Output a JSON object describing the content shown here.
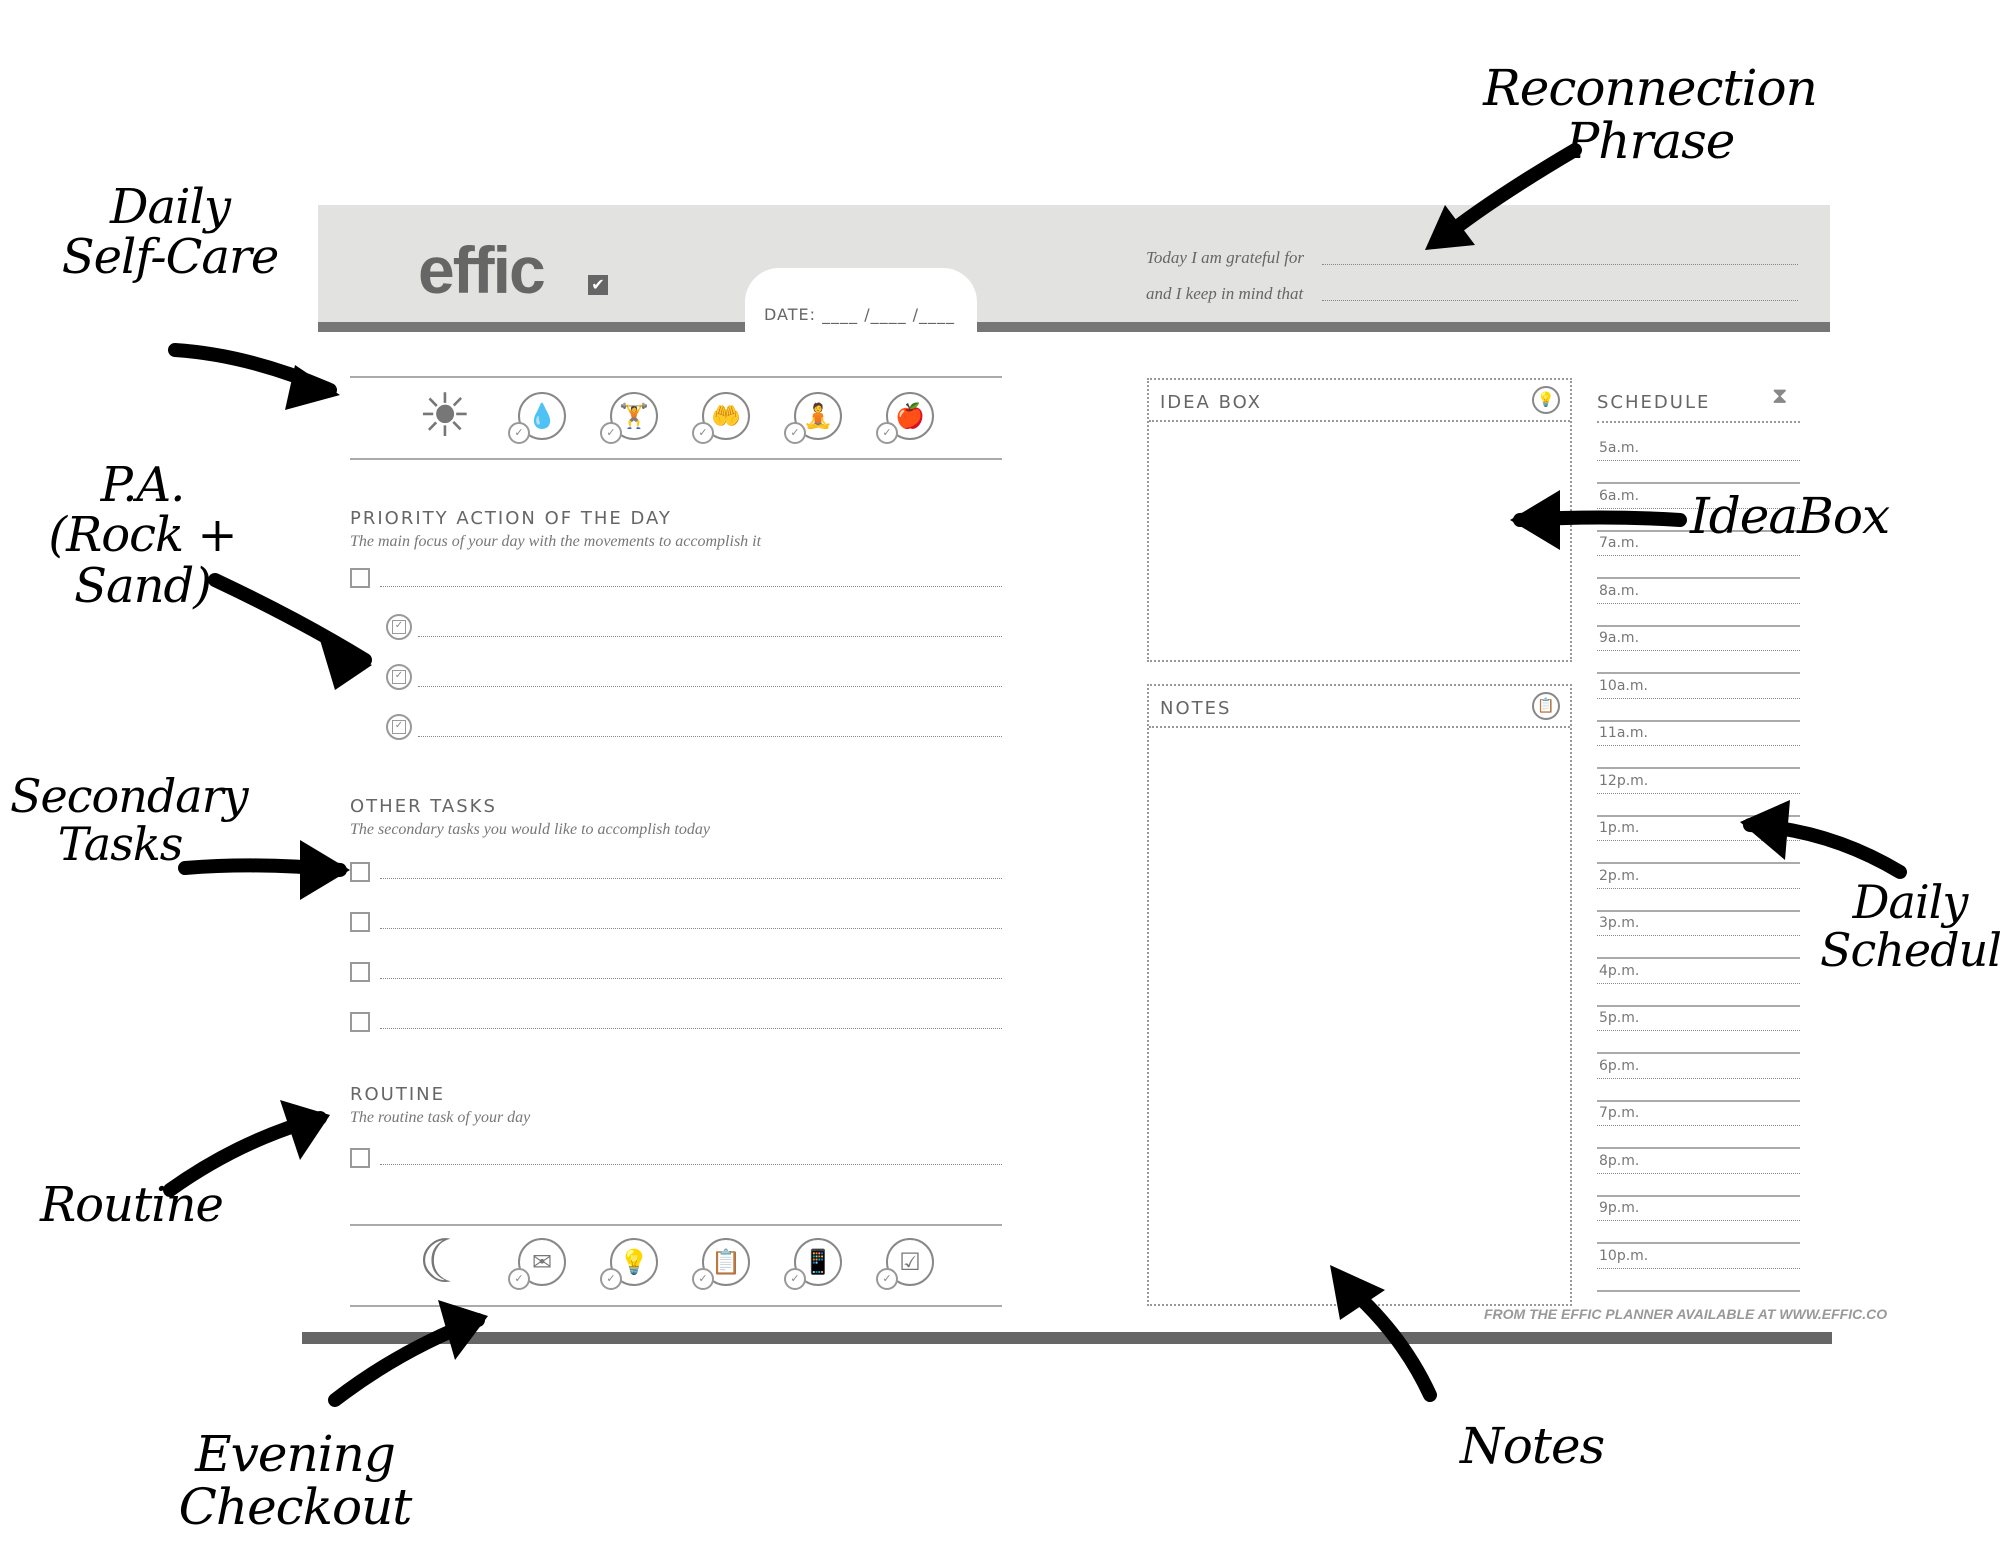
{
  "header": {
    "logo": "effic",
    "logo_check": "✔",
    "date_label": "DATE: ____ /____ /____",
    "reconnection": [
      {
        "label": "Today I am grateful for"
      },
      {
        "label": "and I keep in mind that"
      }
    ]
  },
  "self_care_icons": [
    {
      "name": "sun-icon",
      "glyph": "☀"
    },
    {
      "name": "water-drop-icon",
      "glyph": "💧"
    },
    {
      "name": "dumbbell-icon",
      "glyph": "🏋"
    },
    {
      "name": "hands-icon",
      "glyph": "🤲"
    },
    {
      "name": "meditation-icon",
      "glyph": "🧘"
    },
    {
      "name": "apple-icon",
      "glyph": "🍎"
    }
  ],
  "priority": {
    "title": "PRIORITY ACTION OF THE DAY",
    "subtitle": "The main focus of your day with the movements to accomplish it",
    "rows": 4
  },
  "other_tasks": {
    "title": "OTHER TASKS",
    "subtitle": "The secondary tasks you would like to accomplish today",
    "rows": 4
  },
  "routine": {
    "title": "ROUTINE",
    "subtitle": "The routine task of your day",
    "rows": 1
  },
  "evening_icons": [
    {
      "name": "moon-icon",
      "glyph": "☾"
    },
    {
      "name": "envelope-icon",
      "glyph": "✉"
    },
    {
      "name": "lightbulb-book-icon",
      "glyph": "💡"
    },
    {
      "name": "clipboard-icon",
      "glyph": "📋"
    },
    {
      "name": "phone-sleep-icon",
      "glyph": "📱"
    },
    {
      "name": "checklist-icon",
      "glyph": "☑"
    }
  ],
  "idea_box": {
    "title": "IDEA BOX",
    "icon": "💡"
  },
  "notes": {
    "title": "NOTES",
    "icon": "📋"
  },
  "schedule": {
    "title": "SCHEDULE",
    "icon": "⧗",
    "times": [
      "5a.m.",
      "6a.m.",
      "7a.m.",
      "8a.m.",
      "9a.m.",
      "10a.m.",
      "11a.m.",
      "12p.m.",
      "1p.m.",
      "2p.m.",
      "3p.m.",
      "4p.m.",
      "5p.m.",
      "6p.m.",
      "7p.m.",
      "8p.m.",
      "9p.m.",
      "10p.m."
    ]
  },
  "footer": "FROM THE EFFIC PLANNER AVAILABLE AT WWW.EFFIC.CO",
  "annotations": {
    "reconnection": "Reconnection Phrase",
    "self_care": [
      "Daily",
      "Self-Care"
    ],
    "priority": [
      "P.A.",
      "(Rock + Sand)"
    ],
    "secondary": [
      "Secondary",
      "Tasks"
    ],
    "idea_box": "IdeaBox",
    "schedule": [
      "Daily",
      "Schedule"
    ],
    "routine": "Routine",
    "evening": "Evening Checkout",
    "notes": "Notes"
  }
}
